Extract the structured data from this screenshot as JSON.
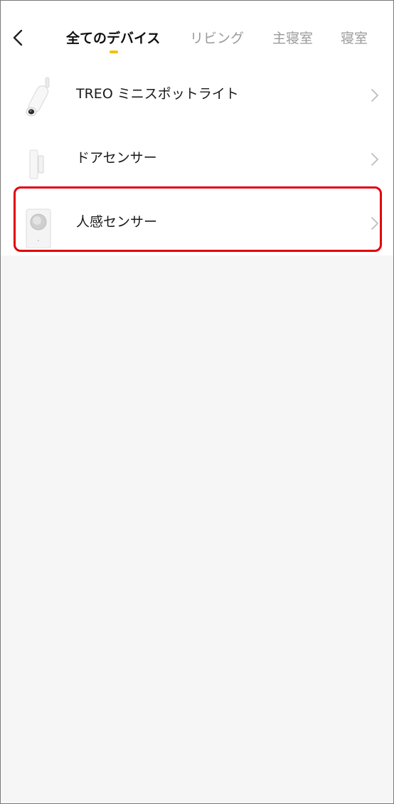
{
  "header": {
    "back_icon": "chevron-left-icon",
    "tabs": [
      {
        "label": "全てのデバイス",
        "active": true
      },
      {
        "label": "リビング",
        "active": false
      },
      {
        "label": "主寝室",
        "active": false
      },
      {
        "label": "寝室",
        "active": false
      }
    ],
    "indicator_color": "#f2c200"
  },
  "devices": [
    {
      "name": "TREO ミニスポットライト",
      "icon": "spotlight-icon"
    },
    {
      "name": "ドアセンサー",
      "icon": "door-sensor-icon"
    },
    {
      "name": "人感センサー",
      "icon": "motion-sensor-icon",
      "highlighted": true
    }
  ],
  "highlight_color": "#e1000f"
}
